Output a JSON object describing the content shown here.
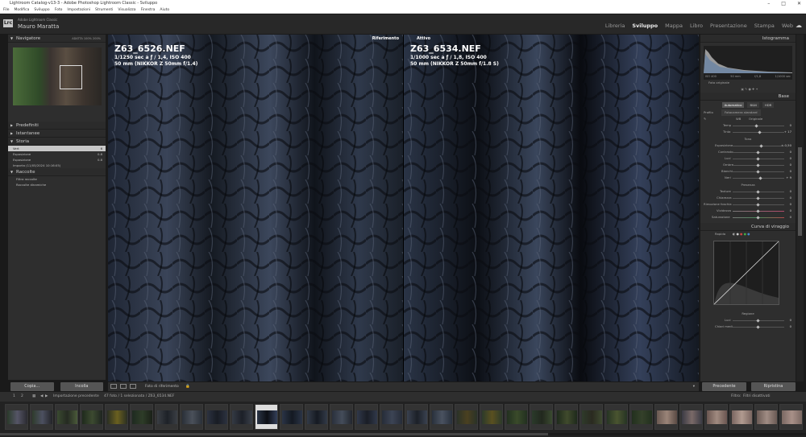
{
  "window": {
    "title": "Lightroom Catalog-v13-3 - Adobe Photoshop Lightroom Classic - Sviluppo",
    "controls": [
      "–",
      "□",
      "✕"
    ]
  },
  "menu": [
    "File",
    "Modifica",
    "Sviluppo",
    "Foto",
    "Impostazioni",
    "Strumenti",
    "Visualizza",
    "Finestra",
    "Aiuto"
  ],
  "identity": {
    "logo": "Lrc",
    "app_name": "Adobe Lightroom Classic",
    "user": "Mauro Maratta"
  },
  "modules": [
    {
      "label": "Libreria",
      "active": false
    },
    {
      "label": "Sviluppo",
      "active": true
    },
    {
      "label": "Mappa",
      "active": false
    },
    {
      "label": "Libro",
      "active": false
    },
    {
      "label": "Presentazione",
      "active": false
    },
    {
      "label": "Stampa",
      "active": false
    },
    {
      "label": "Web",
      "active": false
    }
  ],
  "left": {
    "navigator": {
      "title": "Navigatore",
      "zoom_opts": "ADATTA  100%  200%"
    },
    "predefiniti": "Predefiniti",
    "istantanee": "Istantanee",
    "storia": {
      "title": "Storia",
      "items": [
        {
          "label": "Vert",
          "value": "6",
          "selected": true
        },
        {
          "label": "Esposizione",
          "value": "0.8",
          "selected": false
        },
        {
          "label": "Esposizione",
          "value": "0.8",
          "selected": false
        },
        {
          "label": "Importa (11/05/2024 10:16:05)",
          "value": "",
          "selected": false
        }
      ]
    },
    "raccolte": {
      "title": "Raccolte",
      "items": [
        "Filtra raccolte",
        "Raccolte dinamiche"
      ]
    },
    "buttons": {
      "copy": "Copia...",
      "paste": "Incolla"
    }
  },
  "view": {
    "ref_tag": "Riferimento",
    "active_tag": "Attivo",
    "ref": {
      "name": "Z63_6526.NEF",
      "exposure": "1/1250 sec a ƒ / 1,4, ISO 400",
      "lens": "50 mm (NIKKOR Z 50mm f/1.4)"
    },
    "active": {
      "name": "Z63_6534.NEF",
      "exposure": "1/1000 sec a ƒ / 1,8, ISO 400",
      "lens": "50 mm (NIKKOR Z 50mm f/1.8 S)"
    },
    "toolbar_label": "Foto di riferimento"
  },
  "right": {
    "istogramma": "Istogramma",
    "hist_labels": [
      "ISO 400",
      "50 mm",
      "f/1,8",
      "1/1000 sec"
    ],
    "foto_originale": "Foto originale",
    "base": "Base",
    "tabs": [
      {
        "label": "Automatico",
        "on": true
      },
      {
        "label": "B&N",
        "on": false
      },
      {
        "label": "HDR",
        "on": false
      }
    ],
    "profile_label": "Profilo",
    "profile_value": "Fotocamera standard",
    "wb_label": "WB",
    "wb_value": "Originale",
    "sliders_tone": [
      {
        "label": "Temp",
        "value": "0"
      },
      {
        "label": "Tinta",
        "value": "+ 17"
      }
    ],
    "tono_head": "Tono",
    "sliders_tono": [
      {
        "label": "Esposizione",
        "value": "+ 0,50"
      },
      {
        "label": "Contrasto",
        "value": "0"
      },
      {
        "label": "Luci",
        "value": "0"
      },
      {
        "label": "Ombre",
        "value": "0"
      },
      {
        "label": "Bianchi",
        "value": "0"
      },
      {
        "label": "Neri",
        "value": "+ 9"
      }
    ],
    "presenza_head": "Presenza",
    "sliders_presenza": [
      {
        "label": "Texture",
        "value": "0"
      },
      {
        "label": "Chiarezza",
        "value": "0"
      },
      {
        "label": "Rimozione foschia",
        "value": "0"
      },
      {
        "label": "Vividezza",
        "value": "0"
      },
      {
        "label": "Saturazione",
        "value": "0"
      }
    ],
    "curva": "Curva di viraggio",
    "rapida": "Rapida",
    "regione": "Regione",
    "sliders_regione": [
      {
        "label": "Luci",
        "value": "0"
      },
      {
        "label": "Chiari medi",
        "value": "0"
      }
    ],
    "buttons": {
      "prev": "Precedente",
      "reset": "Ripristina"
    }
  },
  "filmstrip": {
    "pages": [
      "1",
      "2"
    ],
    "source": "Importazione precedente",
    "info": "47 foto / 1 selezionata / Z63_6534.NEF",
    "filter_label": "Filtro:",
    "filter_value": "Filtri disattivati"
  }
}
